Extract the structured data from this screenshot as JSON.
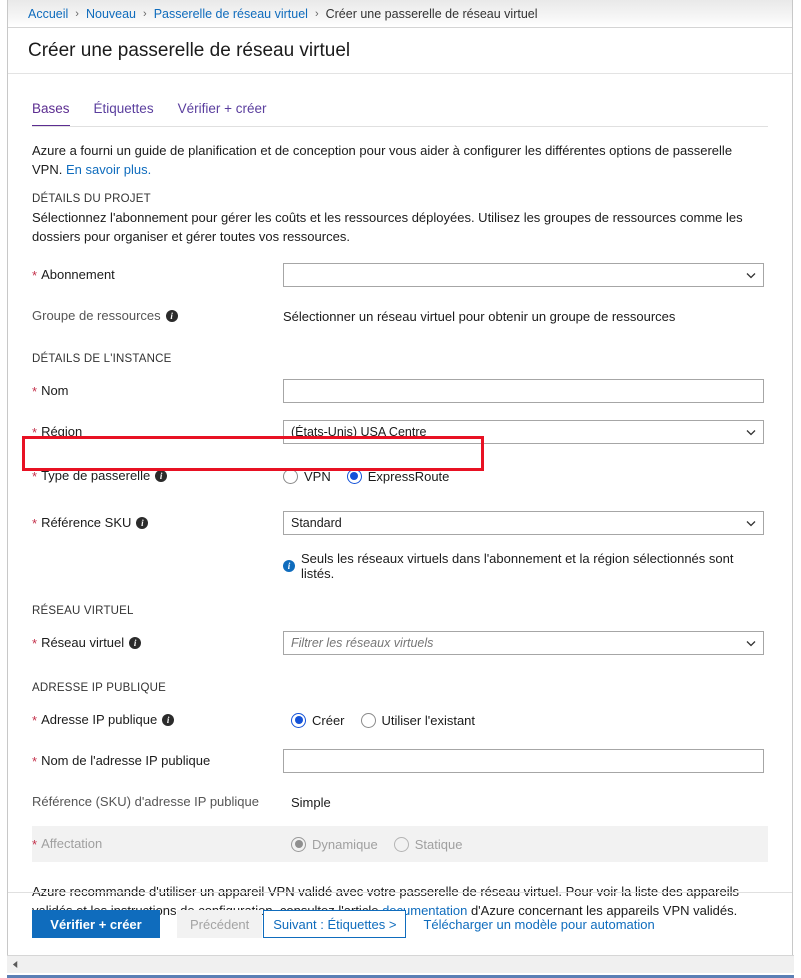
{
  "breadcrumb": {
    "items": [
      {
        "label": "Accueil",
        "link": true
      },
      {
        "label": "Nouveau",
        "link": true
      },
      {
        "label": "Passerelle de réseau virtuel",
        "link": true
      },
      {
        "label": "Créer une passerelle de réseau virtuel",
        "link": false
      }
    ],
    "separator": "›"
  },
  "header": {
    "title": "Créer une passerelle de réseau virtuel"
  },
  "tabs": [
    {
      "label": "Bases",
      "active": true
    },
    {
      "label": "Étiquettes",
      "active": false
    },
    {
      "label": "Vérifier + créer",
      "active": false
    }
  ],
  "intro": {
    "text": "Azure a fourni un guide de planification et de conception pour vous aider à configurer les différentes options de passerelle VPN.",
    "link": "En savoir plus."
  },
  "project_details": {
    "heading": "DÉTAILS DU PROJET",
    "description": "Sélectionnez l'abonnement pour gérer les coûts et les ressources déployées. Utilisez les groupes de ressources comme les dossiers pour organiser et gérer toutes vos ressources.",
    "subscription": {
      "label": "Abonnement",
      "required": true,
      "value": "",
      "placeholder": ""
    },
    "resource_group": {
      "label": "Groupe de ressources",
      "required": false,
      "info": true,
      "value": "Sélectionner un réseau virtuel pour obtenir un groupe de ressources"
    }
  },
  "instance_details": {
    "heading": "DÉTAILS DE L'INSTANCE",
    "name": {
      "label": "Nom",
      "required": true,
      "value": "",
      "placeholder": ""
    },
    "region": {
      "label": "Région",
      "required": true,
      "value": "(États-Unis) USA Centre"
    },
    "gateway_type": {
      "label": "Type de passerelle",
      "required": true,
      "info": true,
      "highlighted": true,
      "options": [
        {
          "label": "VPN",
          "checked": false
        },
        {
          "label": "ExpressRoute",
          "checked": true
        }
      ]
    },
    "sku": {
      "label": "Référence SKU",
      "required": true,
      "info": true,
      "value": "Standard"
    },
    "sku_note": "Seuls les réseaux virtuels dans l'abonnement et la région sélectionnés sont listés."
  },
  "virtual_network": {
    "heading": "RÉSEAU VIRTUEL",
    "vnet": {
      "label": "Réseau virtuel",
      "required": true,
      "info": true,
      "value": "",
      "placeholder": "Filtrer les réseaux virtuels"
    }
  },
  "public_ip": {
    "heading": "ADRESSE IP PUBLIQUE",
    "public_ip_address": {
      "label": "Adresse IP publique",
      "required": true,
      "info": true,
      "options": [
        {
          "label": "Créer",
          "checked": true
        },
        {
          "label": "Utiliser l'existant",
          "checked": false
        }
      ]
    },
    "public_ip_name": {
      "label": "Nom de l'adresse IP publique",
      "required": true,
      "value": "",
      "placeholder": ""
    },
    "public_ip_sku": {
      "label": "Référence (SKU) d'adresse IP publique",
      "required": false,
      "value": "Simple"
    },
    "assignment": {
      "label": "Affectation",
      "required": true,
      "disabled": true,
      "options": [
        {
          "label": "Dynamique",
          "checked": true
        },
        {
          "label": "Statique",
          "checked": false
        }
      ]
    }
  },
  "footer_note": {
    "before": "Azure recommande d'utiliser un appareil VPN validé avec votre passerelle de réseau virtuel. Pour voir la liste des appareils validés et les instructions de configuration, consultez l'article ",
    "link": "documentation",
    "after": " d'Azure concernant les appareils VPN validés."
  },
  "footer": {
    "review_create": "Vérifier + créer",
    "previous": "Précédent",
    "next": "Suivant : Étiquettes >",
    "download_template": "Télécharger un modèle pour automation"
  },
  "colors": {
    "accent_blue": "#0f6cbd",
    "tab_purple": "#5c2d91",
    "required_red": "#c4314b",
    "highlight_red": "#e81123",
    "radio_blue": "#1352d8"
  }
}
